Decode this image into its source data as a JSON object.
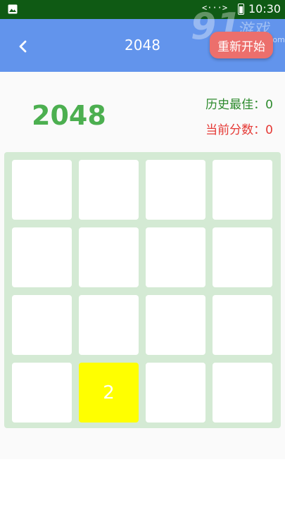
{
  "status_bar": {
    "signal_text": "<···>",
    "time": "10:30"
  },
  "watermark": {
    "logo": "91",
    "chinese": "游戏",
    "site": "91danji.com"
  },
  "app_bar": {
    "title": "2048",
    "restart_label": "重新开始"
  },
  "scores": {
    "logo": "2048",
    "best_label": "历史最佳：",
    "best_value": "0",
    "current_label": "当前分数：",
    "current_value": "0"
  },
  "board": {
    "rows": [
      [
        "",
        "",
        "",
        ""
      ],
      [
        "",
        "",
        "",
        ""
      ],
      [
        "",
        "",
        "",
        ""
      ],
      [
        "",
        "2",
        "",
        ""
      ]
    ]
  },
  "colors": {
    "status_bar": "#0f5a14",
    "app_bar": "#6294ec",
    "restart_button": "#ec6f6c",
    "logo": "#4caf50",
    "best_score": "#2e8b2e",
    "current_score": "#e53935",
    "board": "#d4ead4",
    "tile_2": "#ffff00"
  }
}
